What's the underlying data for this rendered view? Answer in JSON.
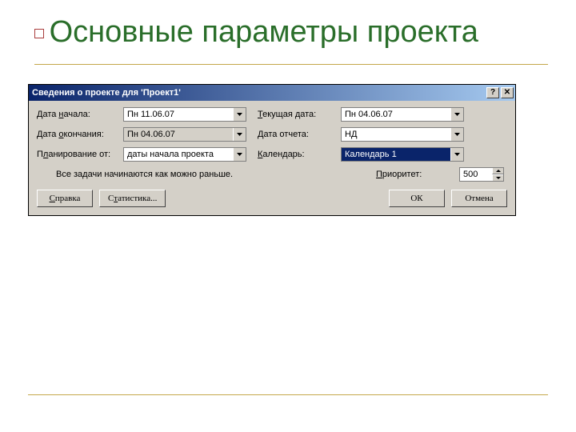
{
  "slide": {
    "title": "Основные параметры проекта"
  },
  "dialog": {
    "title": "Сведения о проекте для 'Проект1'",
    "helpBtn": "?",
    "closeBtn": "✕",
    "labels": {
      "startDate": "Дата начала:",
      "startDate_u": "н",
      "endDate": "Дата окончания:",
      "endDate_u": "о",
      "planFrom": "Планирование от:",
      "planFrom_u": "л",
      "currentDate": "Текущая дата:",
      "currentDate_u": "Т",
      "reportDate": "Дата отчета:",
      "reportDate_u": "Д",
      "calendar": "Календарь:",
      "calendar_u": "К",
      "priority": "Приоритет:",
      "priority_u": "П"
    },
    "values": {
      "startDate": "Пн 11.06.07",
      "endDate": "Пн 04.06.07",
      "planFrom": "даты начала проекта",
      "currentDate": "Пн 04.06.07",
      "reportDate": "НД",
      "calendar": "Календарь 1",
      "priority": "500"
    },
    "note": "Все задачи начинаются как можно раньше.",
    "buttons": {
      "help": "Справка",
      "help_u": "С",
      "stats": "Статистика...",
      "stats_u": "т",
      "ok": "ОК",
      "cancel": "Отмена"
    }
  }
}
